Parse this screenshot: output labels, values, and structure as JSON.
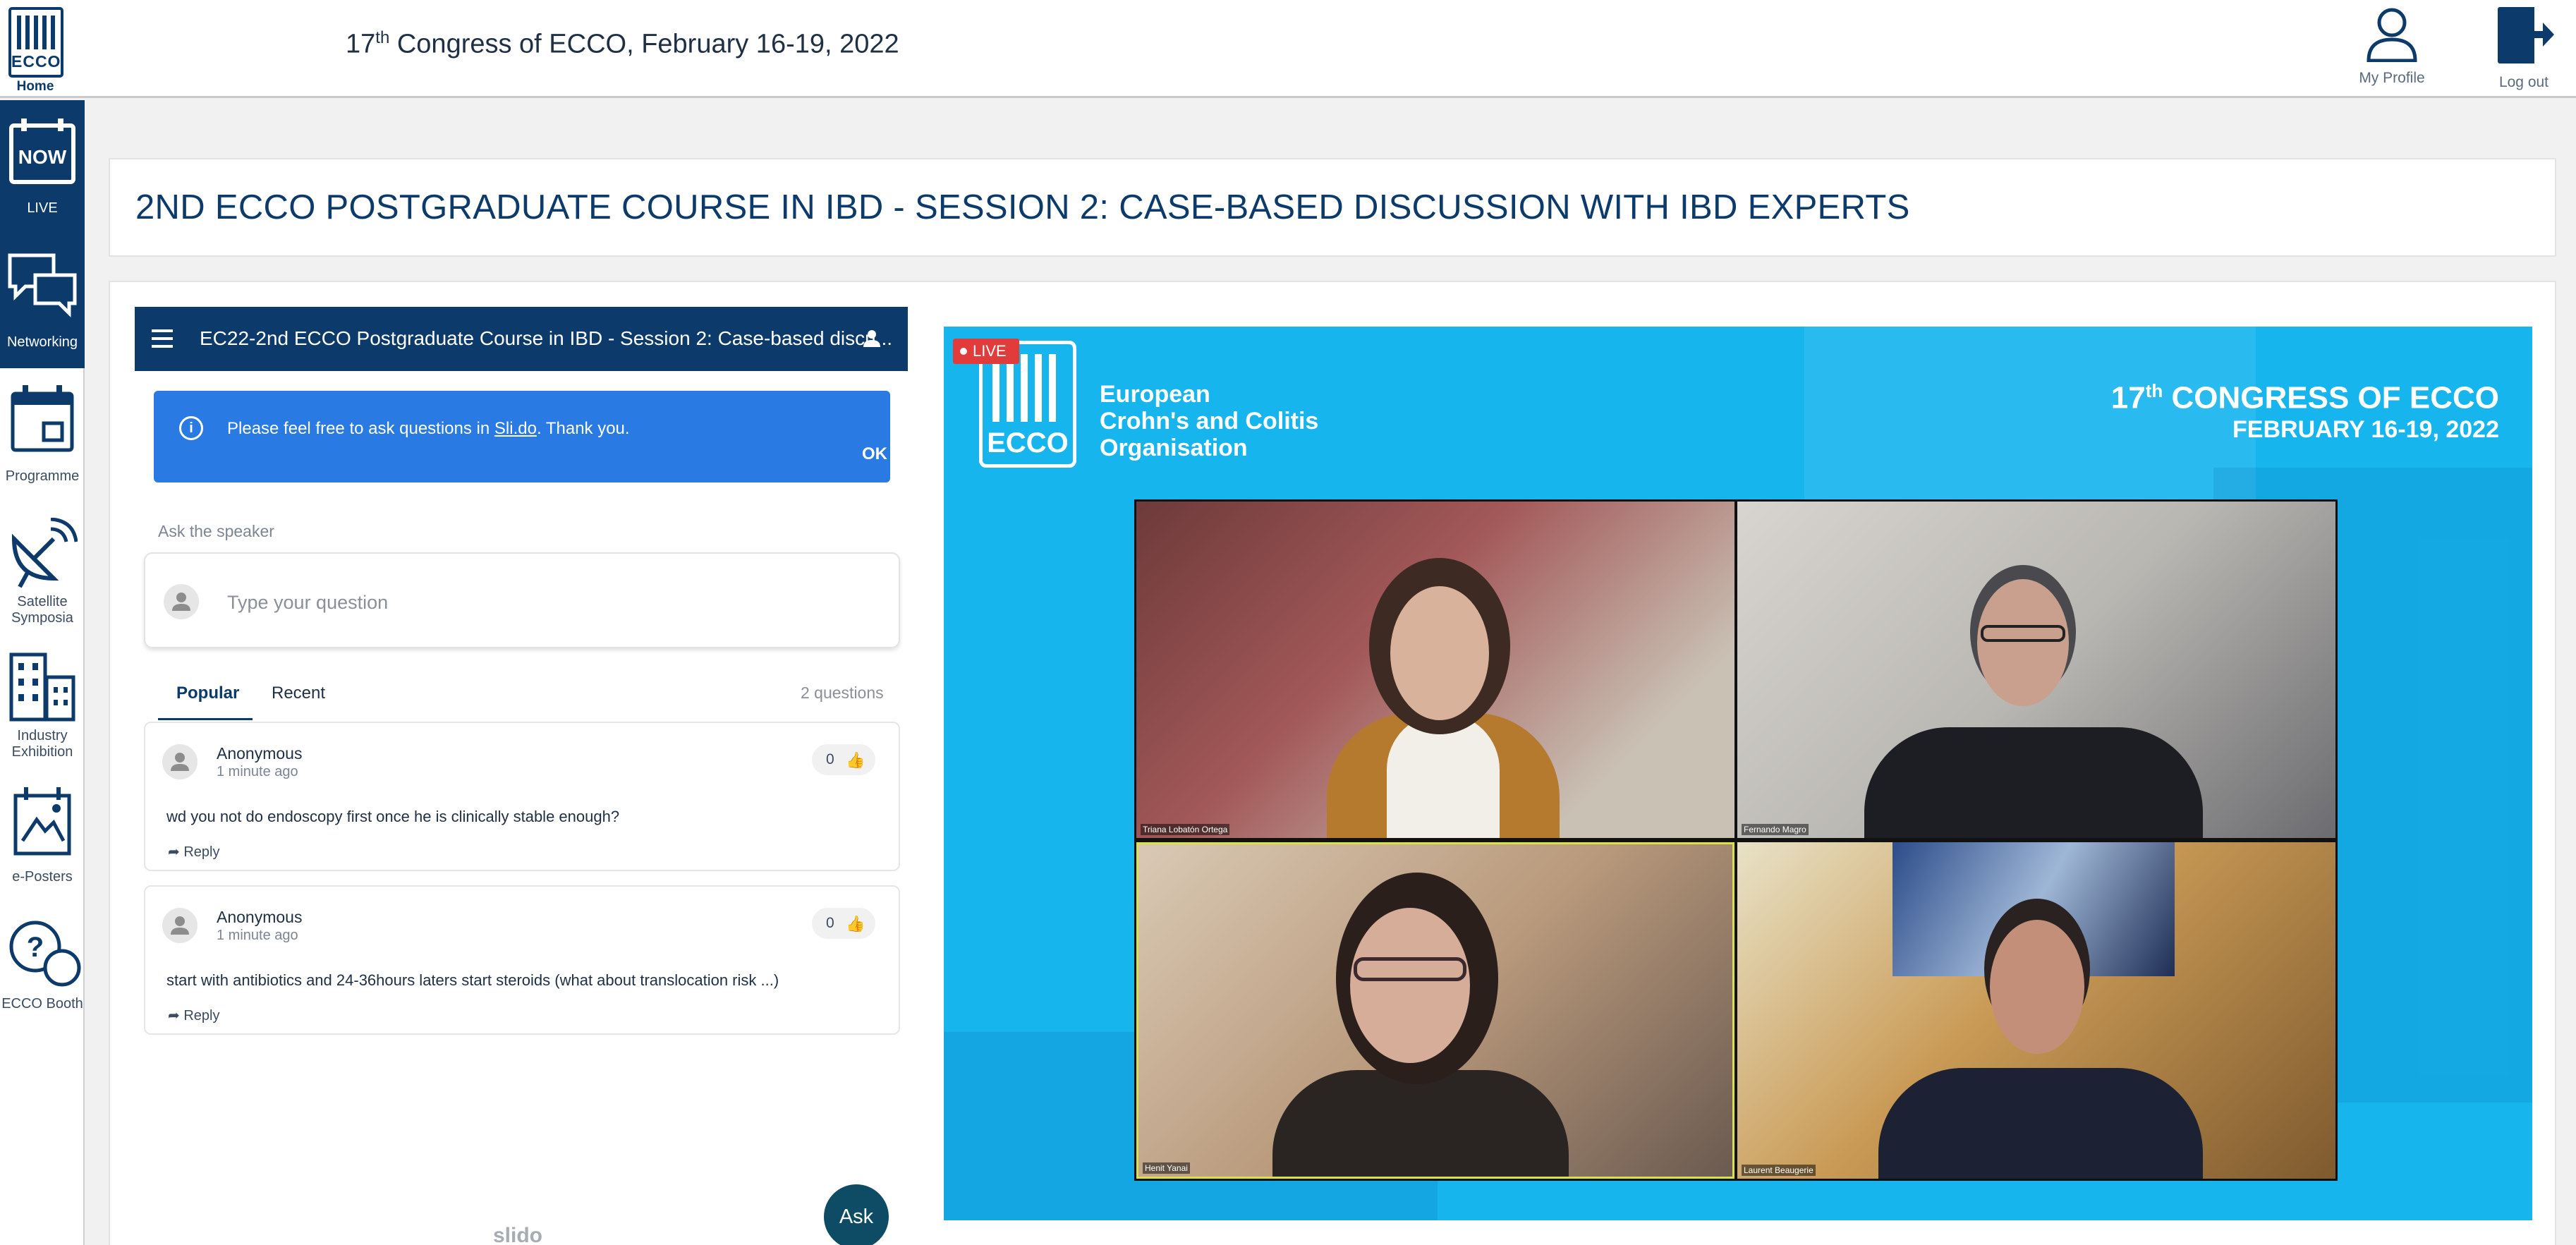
{
  "header": {
    "home_label": "Home",
    "logo_text": "ECCO",
    "conference_prefix": "17",
    "conference_sup": "th",
    "conference_rest": " Congress of ECCO, February 16-19, 2022",
    "my_profile_label": "My Profile",
    "log_out_label": "Log out"
  },
  "sidebar": {
    "items": [
      {
        "label": "LIVE",
        "icon": "now-icon",
        "badge": "NOW"
      },
      {
        "label": "Networking",
        "icon": "chat-bubbles-icon"
      },
      {
        "label": "Programme",
        "icon": "calendar-icon"
      },
      {
        "label": "Satellite Symposia",
        "icon": "satellite-dish-icon"
      },
      {
        "label": "Industry Exhibition",
        "icon": "buildings-icon"
      },
      {
        "label": "e-Posters",
        "icon": "poster-icon"
      },
      {
        "label": "ECCO Booth",
        "icon": "question-bubbles-icon"
      }
    ]
  },
  "session": {
    "title": "2ND ECCO POSTGRADUATE COURSE IN IBD - SESSION 2: CASE-BASED DISCUSSION WITH IBD EXPERTS"
  },
  "slido": {
    "bar_title": "EC22-2nd ECCO Postgraduate Course in IBD - Session 2: Case-based discu...",
    "notice_before": "Please feel free to ask questions in ",
    "notice_link": "Sli.do",
    "notice_after": ". Thank you.",
    "notice_ok": "OK",
    "ask_label": "Ask the speaker",
    "ask_placeholder": "Type your question",
    "tabs": [
      "Popular",
      "Recent"
    ],
    "question_count": "2 questions",
    "questions": [
      {
        "author": "Anonymous",
        "time": "1 minute ago",
        "likes": "0",
        "text": "wd you not do endoscopy first once he is clinically stable enough?",
        "reply": "Reply"
      },
      {
        "author": "Anonymous",
        "time": "1 minute ago",
        "likes": "0",
        "text": "start with antibiotics and 24-36hours laters start steroids (what about translocation risk ...)",
        "reply": "Reply"
      }
    ],
    "ask_button": "Ask",
    "footer_logo": "slido"
  },
  "video": {
    "live_label": "LIVE",
    "logo_text": "ECCO",
    "org_line1": "European",
    "org_line2": "Crohn's and Colitis",
    "org_line3": "Organisation",
    "congress_line1_prefix": "17",
    "congress_line1_sup": "th",
    "congress_line1_rest": " CONGRESS OF ECCO",
    "congress_line2": "FEBRUARY 16-19, 2022",
    "participants": [
      "Triana Lobatón Ortega",
      "Fernando Magro",
      "Henit Yanai",
      "Laurent Beaugerie"
    ]
  },
  "colors": {
    "brand_navy": "#0b3a6b",
    "notice_blue": "#2a7ae4",
    "video_cyan": "#17b5ee",
    "live_red": "#e23b3b",
    "ask_button": "#0e4c66"
  }
}
